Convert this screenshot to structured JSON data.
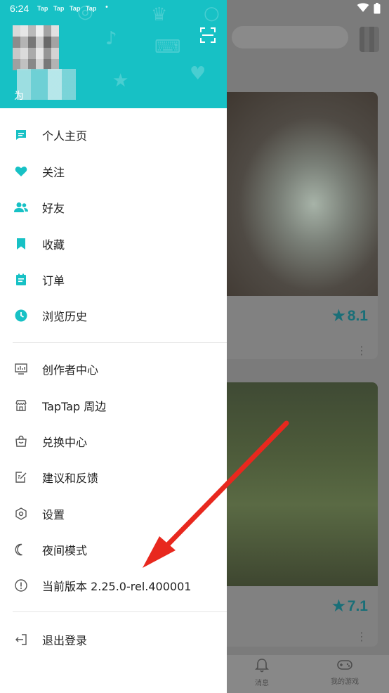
{
  "status_bar": {
    "time": "6:24",
    "tap_badges": [
      "Tap",
      "Tap",
      "Tap",
      "Tap"
    ],
    "dot": "•",
    "wifi_icon": "▼",
    "battery_icon": "▮"
  },
  "drawer": {
    "header_color": "#17c1c5",
    "username_visible_char": "为",
    "accent_color": "#17c1c5",
    "primary_items": [
      {
        "label": "个人主页",
        "icon": "profile-page-icon"
      },
      {
        "label": "关注",
        "icon": "heart-icon"
      },
      {
        "label": "好友",
        "icon": "friends-icon"
      },
      {
        "label": "收藏",
        "icon": "bookmark-icon"
      },
      {
        "label": "订单",
        "icon": "order-icon"
      },
      {
        "label": "浏览历史",
        "icon": "clock-icon"
      }
    ],
    "secondary_items": [
      {
        "label": "创作者中心",
        "icon": "creator-center-icon"
      },
      {
        "label": "TapTap 周边",
        "icon": "store-icon"
      },
      {
        "label": "兑换中心",
        "icon": "redeem-bag-icon"
      },
      {
        "label": "建议和反馈",
        "icon": "feedback-icon"
      },
      {
        "label": "设置",
        "icon": "settings-hexagon-icon"
      },
      {
        "label": "夜间模式",
        "icon": "moon-icon"
      },
      {
        "label": "当前版本 2.25.0-rel.400001",
        "icon": "info-circle-icon"
      }
    ],
    "logout_label": "退出登录"
  },
  "background": {
    "card_1_rating": "8.1",
    "card_2_rating": "7.1",
    "more_glyph": "⋮",
    "star_glyph": "★",
    "tabs": [
      {
        "label": "消息",
        "icon": "bell-icon",
        "glyph": "🔔"
      },
      {
        "label": "我的游戏",
        "icon": "gamepad-icon",
        "glyph": "🎮"
      }
    ]
  },
  "annotation": {
    "arrow_color": "#e8281e"
  }
}
